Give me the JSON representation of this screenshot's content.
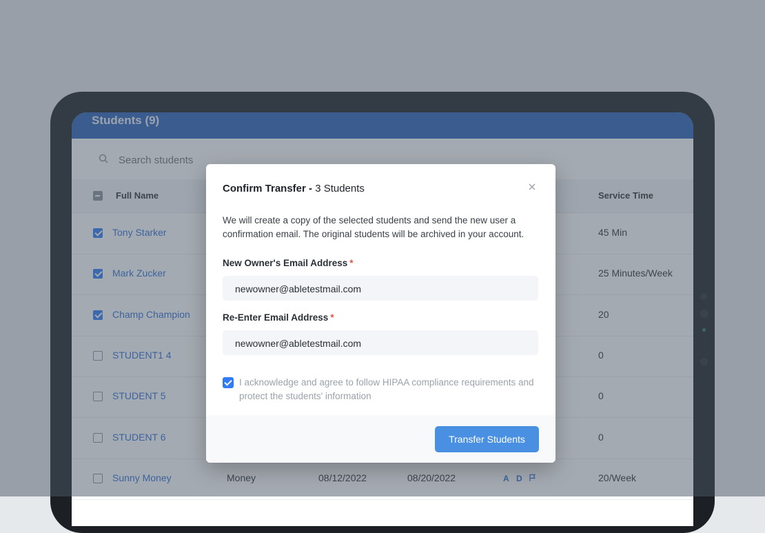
{
  "app": {
    "title": "Students (9)",
    "search_placeholder": "Search students"
  },
  "table": {
    "headers": {
      "full_name": "Full Name",
      "service_time": "Service Time"
    },
    "rows": [
      {
        "name": "Tony Starker",
        "checked": true,
        "service": "45 Min"
      },
      {
        "name": "Mark Zucker",
        "checked": true,
        "service": "25 Minutes/Week"
      },
      {
        "name": "Champ Champion",
        "checked": true,
        "service": "20"
      },
      {
        "name": "STUDENT1 4",
        "checked": false,
        "service": "0"
      },
      {
        "name": "STUDENT 5",
        "checked": false,
        "service": "0"
      },
      {
        "name": "STUDENT 6",
        "checked": false,
        "service": "0"
      },
      {
        "name": "Sunny Money",
        "checked": false,
        "service": "20/Week",
        "provider": "Money",
        "start": "08/12/2022",
        "end": "08/20/2022",
        "flag_a": "A",
        "flag_d": "D"
      }
    ]
  },
  "modal": {
    "title_bold": "Confirm Transfer - ",
    "title_rest": "3 Students",
    "description": "We will create a copy of the selected students and send the new user a confirmation email. The original students will be archived in your account.",
    "email_label": "New Owner's Email Address",
    "email_value": "newowner@abletestmail.com",
    "reenter_label": "Re-Enter Email Address",
    "reenter_value": "newowner@abletestmail.com",
    "required_mark": "*",
    "ack_text": "I acknowledge and agree to follow HIPAA compliance requirements and protect the students' information",
    "ack_checked": true,
    "submit_label": "Transfer Students"
  },
  "icons": {
    "search": "search-icon",
    "close": "close-icon",
    "flag": "flag-icon"
  },
  "colors": {
    "accent": "#2f7cf6",
    "button": "#4a90e2",
    "header": "#2b63b8",
    "required": "#e25341"
  }
}
